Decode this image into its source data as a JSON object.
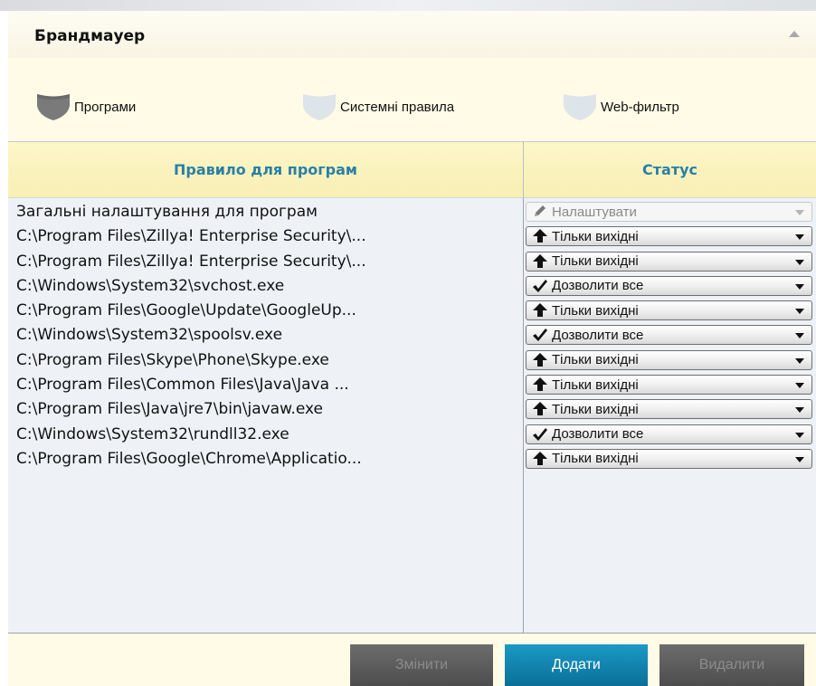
{
  "window": {
    "title": "Брандмауер"
  },
  "tabs": [
    {
      "label": "Програми",
      "icon": "shield-icon",
      "active": true
    },
    {
      "label": "Системні правила",
      "icon": "shield-icon",
      "active": false
    },
    {
      "label": "Web-фильтр",
      "icon": "shield-icon",
      "active": false
    }
  ],
  "table": {
    "columns": [
      "Правило для програм",
      "Статус"
    ],
    "rows": [
      {
        "path": "Загальні налаштування для програм",
        "status": "Налаштувати",
        "status_icon": "pencil-icon",
        "disabled": true
      },
      {
        "path": "C:\\Program Files\\Zillya! Enterprise Security\\...",
        "status": "Тільки вихідні",
        "status_icon": "arrow-up-icon"
      },
      {
        "path": "C:\\Program Files\\Zillya! Enterprise Security\\...",
        "status": "Тільки вихідні",
        "status_icon": "arrow-up-icon"
      },
      {
        "path": "C:\\Windows\\System32\\svchost.exe",
        "status": "Дозволити все",
        "status_icon": "checkmark-icon"
      },
      {
        "path": "C:\\Program Files\\Google\\Update\\GoogleUp...",
        "status": "Тільки вихідні",
        "status_icon": "arrow-up-icon"
      },
      {
        "path": "C:\\Windows\\System32\\spoolsv.exe",
        "status": "Дозволити все",
        "status_icon": "checkmark-icon"
      },
      {
        "path": "C:\\Program Files\\Skype\\Phone\\Skype.exe",
        "status": "Тільки вихідні",
        "status_icon": "arrow-up-icon"
      },
      {
        "path": "C:\\Program Files\\Common Files\\Java\\Java ...",
        "status": "Тільки вихідні",
        "status_icon": "arrow-up-icon"
      },
      {
        "path": "C:\\Program Files\\Java\\jre7\\bin\\javaw.exe",
        "status": "Тільки вихідні",
        "status_icon": "arrow-up-icon"
      },
      {
        "path": "C:\\Windows\\System32\\rundll32.exe",
        "status": "Дозволити все",
        "status_icon": "checkmark-icon"
      },
      {
        "path": "C:\\Program Files\\Google\\Chrome\\Applicatio...",
        "status": "Тільки вихідні",
        "status_icon": "arrow-up-icon"
      }
    ]
  },
  "buttons": {
    "edit_label": "Змінити",
    "add_label": "Додати",
    "delete_label": "Видалити"
  },
  "colors": {
    "accent": "#2a7fa6",
    "primary_button": "#0f86b3",
    "disabled_button": "#5d5d5d",
    "panel_background": "#fffbe6",
    "header_background": "#f8efb4"
  }
}
